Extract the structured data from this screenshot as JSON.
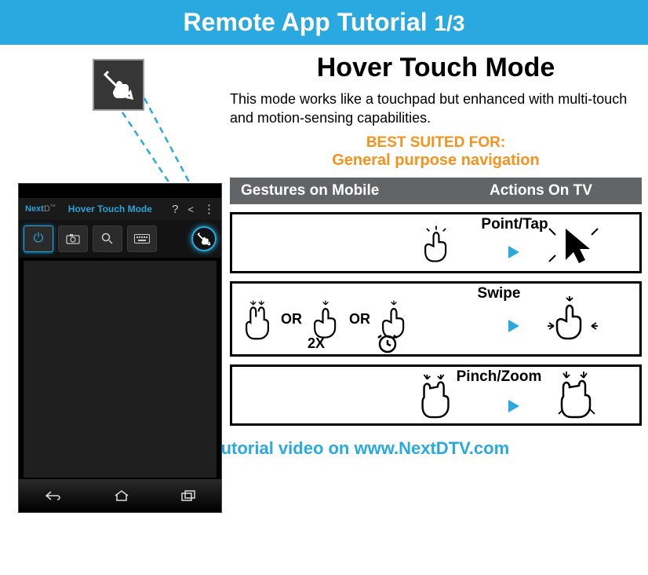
{
  "banner": {
    "title": "Remote App Tutorial",
    "page": "1/3"
  },
  "title": "Hover Touch Mode",
  "description": "This mode works like a touchpad but enhanced with multi-touch and motion-sensing capabilities.",
  "best_label": "BEST SUITED FOR:",
  "best_value": "General purpose navigation",
  "table_header": {
    "col1": "Gestures on Mobile",
    "col2": "Actions On TV"
  },
  "rows": {
    "r1": {
      "label": "Point/Tap"
    },
    "r2": {
      "label": "Swipe",
      "or": "OR",
      "sub_2x": "2X"
    },
    "r3": {
      "label": "Pinch/Zoom"
    }
  },
  "phone": {
    "logo_prefix": "Next",
    "logo_suffix": "D",
    "tm": "™",
    "title": "Hover Touch Mode"
  },
  "footer": "View our tutorial video on www.NextDTV.com"
}
